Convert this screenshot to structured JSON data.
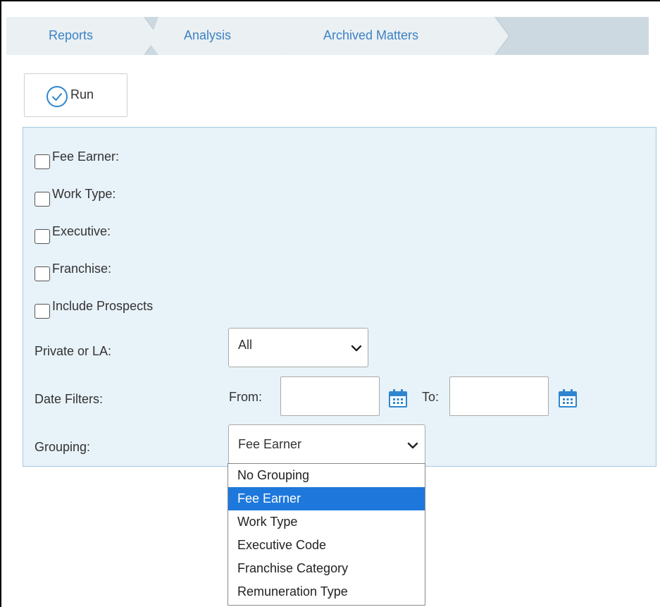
{
  "breadcrumb": {
    "items": [
      {
        "label": "Reports"
      },
      {
        "label": "Analysis"
      },
      {
        "label": "Archived Matters"
      }
    ]
  },
  "toolbar": {
    "run_label": "Run"
  },
  "filters": {
    "checkboxes": [
      {
        "label": "Fee Earner:",
        "checked": false
      },
      {
        "label": "Work Type:",
        "checked": false
      },
      {
        "label": "Executive:",
        "checked": false
      },
      {
        "label": "Franchise:",
        "checked": false
      },
      {
        "label": "Include Prospects",
        "checked": false
      }
    ],
    "private_or_la": {
      "label": "Private or LA:",
      "value": "All"
    },
    "date_filters": {
      "label": "Date Filters:",
      "from_label": "From:",
      "from_value": "",
      "to_label": "To:",
      "to_value": ""
    },
    "grouping": {
      "label": "Grouping:",
      "value": "Fee Earner",
      "options": [
        "No Grouping",
        "Fee Earner",
        "Work Type",
        "Executive Code",
        "Franchise Category",
        "Remuneration Type"
      ],
      "highlighted_option": "Fee Earner"
    }
  },
  "colors": {
    "link": "#3b82c4",
    "panel_bg": "#e8f2f9",
    "panel_border": "#a6c8e0",
    "breadcrumb_bg": "#ccd9e1",
    "selection": "#1e78dc",
    "calendar_icon": "#2f86cf"
  },
  "icons": {
    "run": "check-circle-icon",
    "chevron": "chevron-down-icon",
    "calendar": "calendar-icon"
  }
}
